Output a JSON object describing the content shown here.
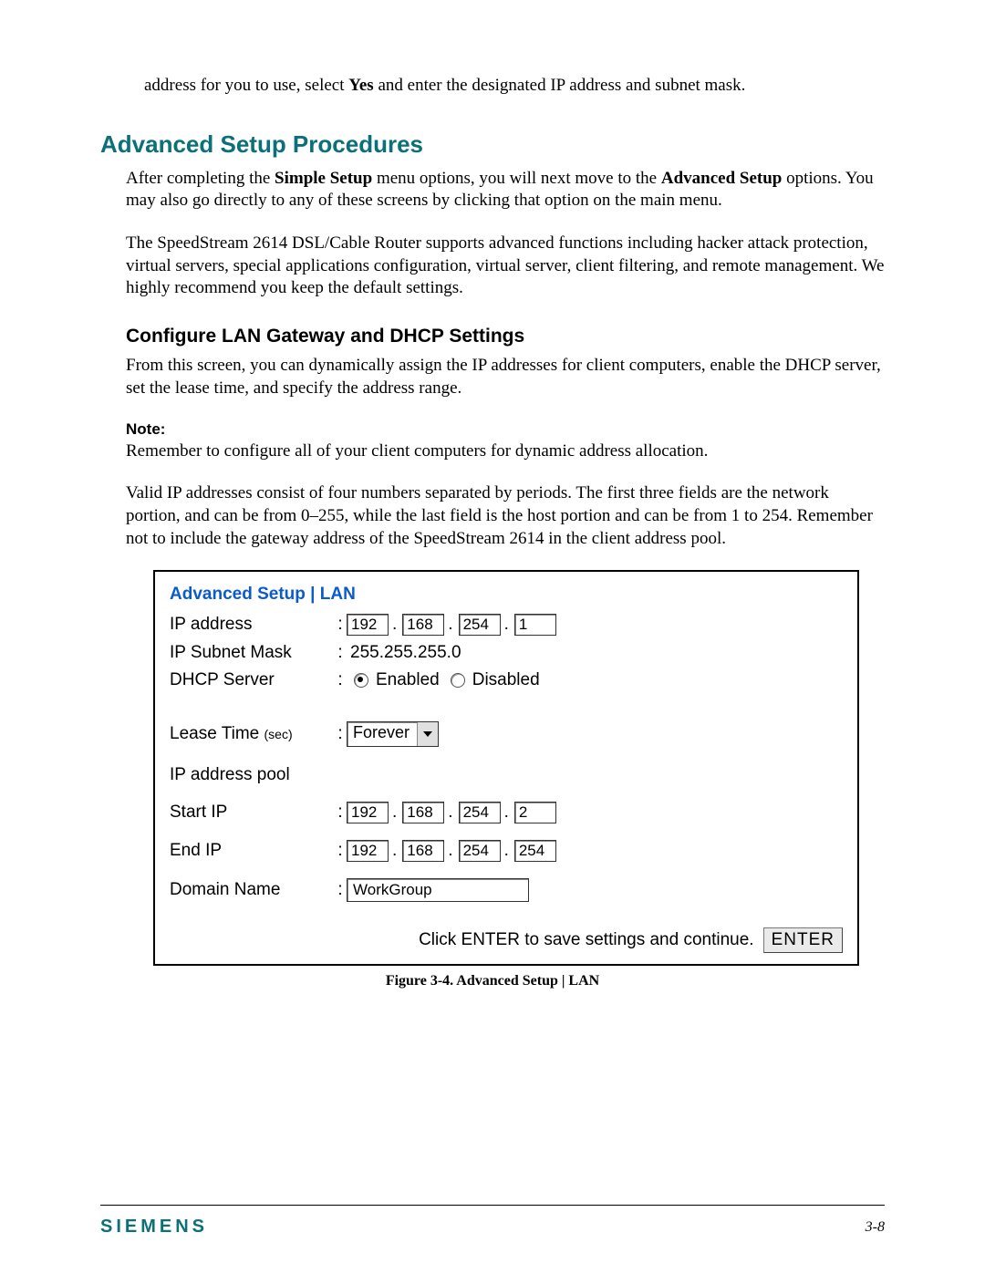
{
  "lead": {
    "prefix": "address for you to use, select ",
    "bold": "Yes",
    "suffix": " and enter the designated IP address and subnet mask."
  },
  "h1": "Advanced Setup Procedures",
  "intro1": {
    "prefix": "After completing the ",
    "bold1": "Simple Setup",
    "mid": " menu options, you will next move to the ",
    "bold2": "Advanced Setup",
    "suffix": " options. You may also go directly to any of these screens by clicking that option on the main menu."
  },
  "intro2": "The SpeedStream 2614 DSL/Cable Router supports advanced functions including hacker attack protection, virtual servers, special applications configuration, virtual server, client filtering, and remote management. We highly recommend you keep the default settings.",
  "h2": "Configure LAN Gateway and DHCP Settings",
  "body1": "From this screen, you can dynamically assign the IP addresses for client computers, enable the DHCP server, set the lease time, and specify the address range.",
  "note_label": "Note:",
  "note_body": "Remember to configure all of your client computers for dynamic address allocation.",
  "body2": "Valid IP addresses consist of four numbers separated by periods. The first three fields are the network portion, and can be from 0–255, while the last field is the host portion and can be from 1 to 254. Remember not to include the gateway address of the SpeedStream 2614 in the client address pool.",
  "screenshot": {
    "title": "Advanced Setup | LAN",
    "labels": {
      "ip_address": "IP address",
      "subnet": "IP Subnet Mask",
      "dhcp": "DHCP Server",
      "lease": "Lease Time ",
      "lease_sub": "(sec)",
      "pool": "IP address pool",
      "start": "Start IP",
      "end": "End IP",
      "domain": "Domain Name"
    },
    "ip_address": [
      "192",
      "168",
      "254",
      "1"
    ],
    "subnet_value": "255.255.255.0",
    "dhcp": {
      "enabled": "Enabled",
      "disabled": "Disabled"
    },
    "lease_value": "Forever",
    "start_ip": [
      "192",
      "168",
      "254",
      "2"
    ],
    "end_ip": [
      "192",
      "168",
      "254",
      "254"
    ],
    "domain_value": "WorkGroup",
    "footer_text": "Click ENTER to save settings and continue.",
    "enter_label": "ENTER"
  },
  "figure_caption": "Figure 3-4.  Advanced Setup | LAN",
  "footer": {
    "brand": "SIEMENS",
    "page": "3-8"
  }
}
